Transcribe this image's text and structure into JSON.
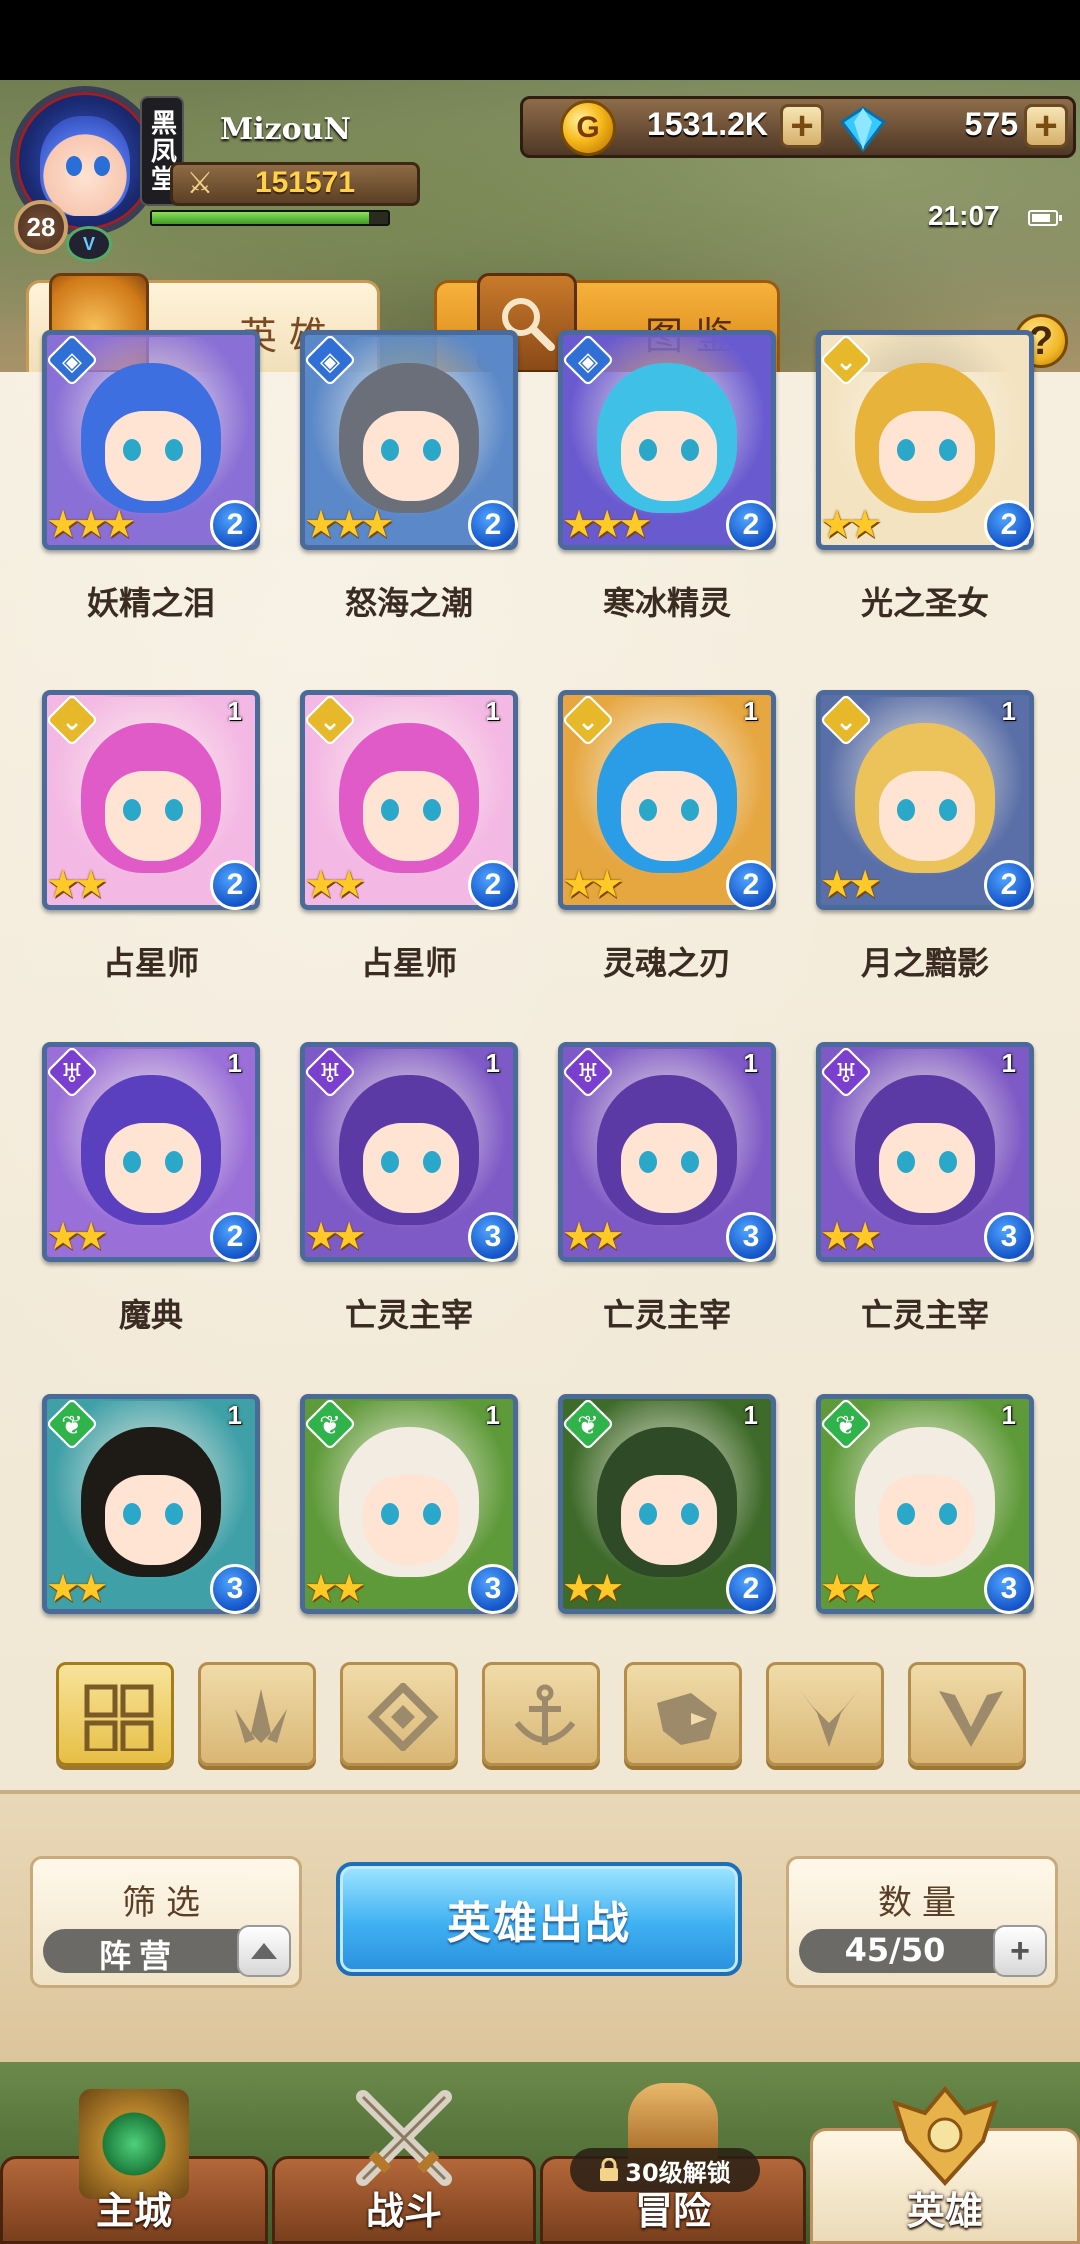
{
  "player": {
    "name": "MizouN",
    "level": "28",
    "guild_tag": "黑凤堂",
    "power": "151571",
    "hp_fraction": 0.92
  },
  "currency": {
    "gold": "1531.2K",
    "gems": "575"
  },
  "status": {
    "time": "21:07"
  },
  "tabs": [
    {
      "label": "英雄",
      "active": true
    },
    {
      "label": "图鉴",
      "active": false
    }
  ],
  "help_label": "?",
  "heroes": [
    {
      "name": "妖精之泪",
      "stars": 3,
      "stage": "2",
      "count": "",
      "faction": "blue",
      "hair": "#3d6fe0",
      "bg": "#8a6fd6"
    },
    {
      "name": "怒海之潮",
      "stars": 3,
      "stage": "2",
      "count": "",
      "faction": "blue",
      "hair": "#6a6f7a",
      "bg": "#5a88c8"
    },
    {
      "name": "寒冰精灵",
      "stars": 3,
      "stage": "2",
      "count": "",
      "faction": "blue",
      "hair": "#3fc0e6",
      "bg": "#6a5ad0"
    },
    {
      "name": "光之圣女",
      "stars": 2,
      "stage": "2",
      "count": "",
      "faction": "gold",
      "hair": "#e8b33a",
      "bg": "#f3e3c0"
    },
    {
      "name": "占星师",
      "stars": 2,
      "stage": "2",
      "count": "1",
      "faction": "gold",
      "hair": "#e05ac8",
      "bg": "#f4b8e4"
    },
    {
      "name": "占星师",
      "stars": 2,
      "stage": "2",
      "count": "1",
      "faction": "gold",
      "hair": "#e05ac8",
      "bg": "#f4b8e4"
    },
    {
      "name": "灵魂之刃",
      "stars": 2,
      "stage": "2",
      "count": "1",
      "faction": "gold",
      "hair": "#2a9de6",
      "bg": "#e6a640"
    },
    {
      "name": "月之黯影",
      "stars": 2,
      "stage": "2",
      "count": "1",
      "faction": "gold",
      "hair": "#ecc25a",
      "bg": "#5a6fa8"
    },
    {
      "name": "魔典",
      "stars": 2,
      "stage": "2",
      "count": "1",
      "faction": "purple",
      "hair": "#5a3fbe",
      "bg": "#9a70d8"
    },
    {
      "name": "亡灵主宰",
      "stars": 2,
      "stage": "3",
      "count": "1",
      "faction": "purple",
      "hair": "#5b3aa6",
      "bg": "#7e5ac6"
    },
    {
      "name": "亡灵主宰",
      "stars": 2,
      "stage": "3",
      "count": "1",
      "faction": "purple",
      "hair": "#5b3aa6",
      "bg": "#7e5ac6"
    },
    {
      "name": "亡灵主宰",
      "stars": 2,
      "stage": "3",
      "count": "1",
      "faction": "purple",
      "hair": "#5b3aa6",
      "bg": "#7e5ac6"
    },
    {
      "name": "",
      "stars": 2,
      "stage": "3",
      "count": "1",
      "faction": "green",
      "hair": "#1e1a16",
      "bg": "#3fa0a8"
    },
    {
      "name": "",
      "stars": 2,
      "stage": "3",
      "count": "1",
      "faction": "green",
      "hair": "#f2ece2",
      "bg": "#5f9a3a"
    },
    {
      "name": "",
      "stars": 2,
      "stage": "2",
      "count": "1",
      "faction": "green",
      "hair": "#2f4a26",
      "bg": "#3e6a2a"
    },
    {
      "name": "",
      "stars": 2,
      "stage": "3",
      "count": "1",
      "faction": "green",
      "hair": "#f2ece2",
      "bg": "#5f9a3a"
    }
  ],
  "filters": [
    {
      "name": "all",
      "active": true
    },
    {
      "name": "forest",
      "active": false
    },
    {
      "name": "diamond",
      "active": false
    },
    {
      "name": "anchor",
      "active": false
    },
    {
      "name": "beast",
      "active": false
    },
    {
      "name": "demon",
      "active": false
    },
    {
      "name": "light",
      "active": false
    }
  ],
  "controls": {
    "filter_title": "筛选",
    "filter_value": "阵营",
    "deploy_label": "英雄出战",
    "quantity_title": "数量",
    "quantity_value": "45/50"
  },
  "nav": [
    {
      "label": "主城",
      "active": false
    },
    {
      "label": "战斗",
      "active": false
    },
    {
      "label": "冒险",
      "active": false,
      "lock": "30级解锁"
    },
    {
      "label": "英雄",
      "active": true
    }
  ],
  "colors": {
    "faction_blue": "#2f6fd6",
    "faction_gold": "#e6b82a",
    "faction_purple": "#7b3fd0",
    "faction_green": "#2fb34a",
    "star": "#ffc928",
    "stage_badge": "#1454c8"
  }
}
